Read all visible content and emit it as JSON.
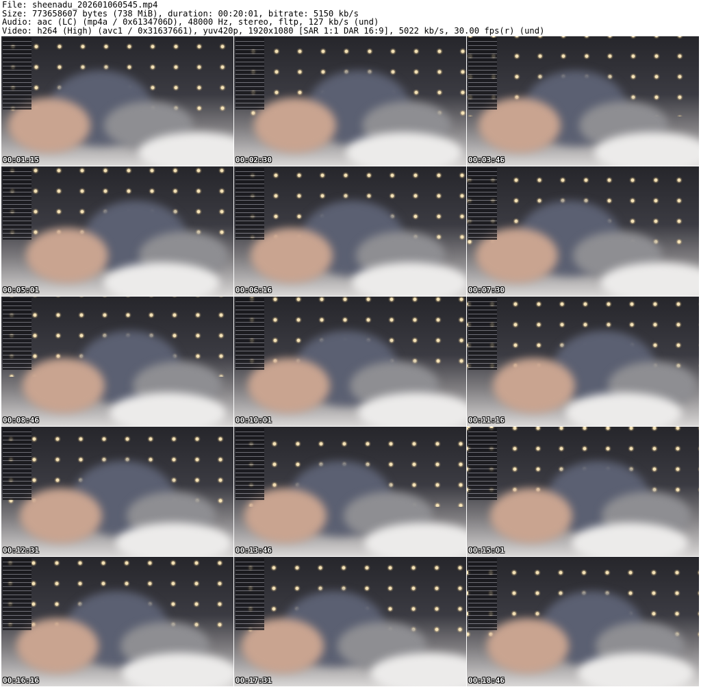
{
  "header": {
    "file": "File: sheenadu_202601060545.mp4",
    "size": "Size: 773658607 bytes (738 MiB), duration: 00:20:01, bitrate: 5150 kb/s",
    "audio": "Audio: aac (LC) (mp4a / 0x6134706D), 48000 Hz, stereo, fltp, 127 kb/s (und)",
    "video": "Video: h264 (High) (avc1 / 0x31637661), yuv420p, 1920x1080 [SAR 1:1 DAR 16:9], 5022 kb/s, 30.00 fps(r) (und)"
  },
  "thumbnails": [
    {
      "timestamp": "00:01:15"
    },
    {
      "timestamp": "00:02:30"
    },
    {
      "timestamp": "00:03:46"
    },
    {
      "timestamp": "00:05:01"
    },
    {
      "timestamp": "00:06:16"
    },
    {
      "timestamp": "00:07:30"
    },
    {
      "timestamp": "00:08:46"
    },
    {
      "timestamp": "00:10:01"
    },
    {
      "timestamp": "00:11:16"
    },
    {
      "timestamp": "00:12:31"
    },
    {
      "timestamp": "00:13:46"
    },
    {
      "timestamp": "00:15:01"
    },
    {
      "timestamp": "00:16:16"
    },
    {
      "timestamp": "00:17:31"
    },
    {
      "timestamp": "00:18:46"
    }
  ]
}
